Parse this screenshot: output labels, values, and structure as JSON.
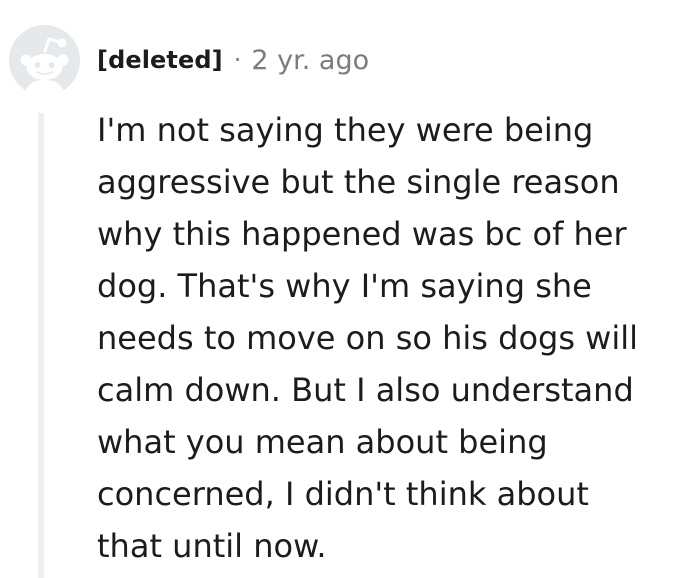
{
  "comment": {
    "author": "[deleted]",
    "separator": "·",
    "timestamp": "2 yr. ago",
    "avatar_icon": "reddit-default-avatar-icon",
    "body_lines": [
      "I'm not saying they were being",
      "aggressive but the single reason",
      "why this happened was bc of her",
      "dog. That's why I'm saying she",
      "needs to move on so his dogs will",
      "calm down. But I also understand",
      "what you mean about being",
      "concerned, I didn't think about",
      "that until now."
    ]
  },
  "colors": {
    "avatar_bg": "#e6e9ec",
    "avatar_fg": "#ffffff",
    "text": "#1c1c1c",
    "meta": "#7c7c7c",
    "thread_line": "#edeff1"
  }
}
